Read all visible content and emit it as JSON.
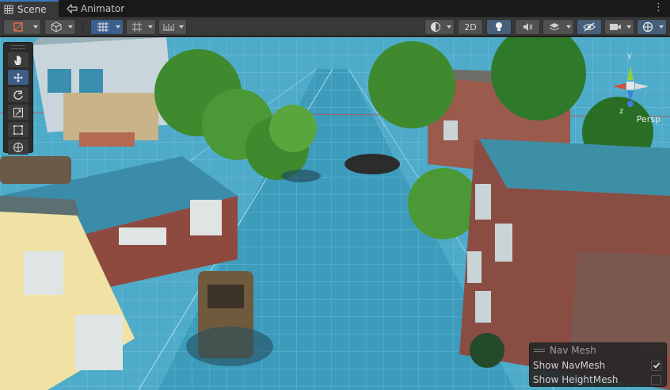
{
  "tabs": [
    {
      "label": "Scene",
      "icon": "scene-grid-icon",
      "active": true
    },
    {
      "label": "Animator",
      "icon": "animator-icon",
      "active": false
    }
  ],
  "toolbar": {
    "view_2d_label": "2D"
  },
  "tools": [
    "hand-tool",
    "move-tool",
    "rotate-tool",
    "scale-tool",
    "rect-tool",
    "transform-tool"
  ],
  "active_tool": "move-tool",
  "gizmo": {
    "projection_label": "Persp",
    "y_label": "y",
    "z_label": "z"
  },
  "nav_overlay": {
    "title": "Nav Mesh",
    "options": [
      {
        "label": "Show NavMesh",
        "checked": true
      },
      {
        "label": "Show HeightMesh",
        "checked": false
      }
    ]
  },
  "colors": {
    "navmesh": "#3aa7c4",
    "accent": "#3a79bb",
    "gizmo_x": "#d84a3a",
    "gizmo_y": "#8ecf3a",
    "gizmo_z": "#3a7fe0"
  }
}
